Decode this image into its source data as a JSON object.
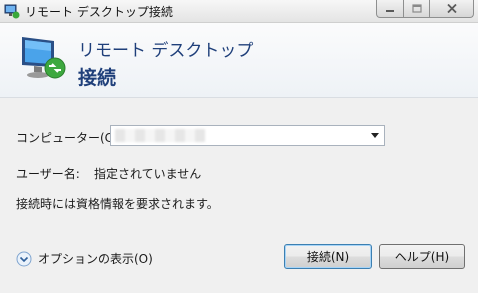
{
  "window": {
    "title": "リモート デスクトップ接続",
    "caption_buttons": {
      "minimize_icon": "minimize-icon",
      "maximize_icon": "maximize-icon",
      "close_icon": "close-icon"
    }
  },
  "header": {
    "app_name": "リモート デスクトップ",
    "heading": "接続",
    "icon": "remote-desktop-monitor-icon"
  },
  "form": {
    "computer_label": "コンピューター(C):",
    "computer_value": "",
    "username_label": "ユーザー名:",
    "username_value": "指定されていません",
    "info_text": "接続時には資格情報を要求されます。"
  },
  "footer": {
    "show_options_label": "オプションの表示(O)",
    "connect_label": "接続(N)",
    "help_label": "ヘルプ(H)"
  },
  "colors": {
    "accent": "#1f3f7a",
    "window_bg": "#f0f0f0",
    "close_button": "#c75050"
  }
}
